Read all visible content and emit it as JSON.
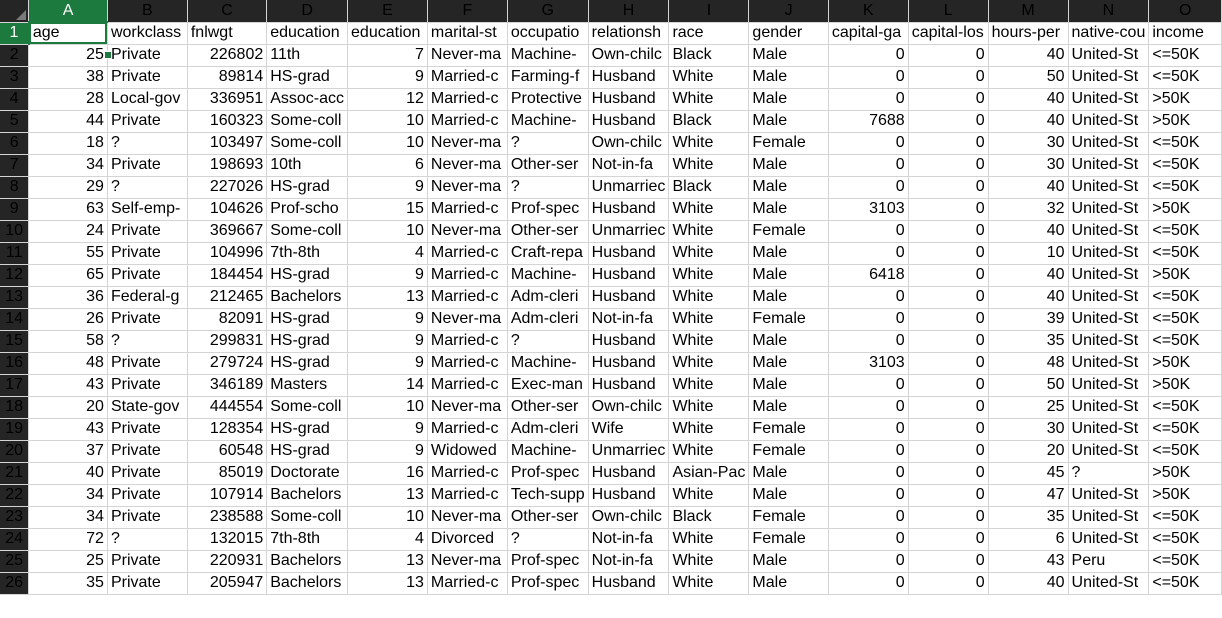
{
  "columns": [
    "A",
    "B",
    "C",
    "D",
    "E",
    "F",
    "G",
    "H",
    "I",
    "J",
    "K",
    "L",
    "M",
    "N",
    "O"
  ],
  "column_types": [
    "num",
    "txt",
    "num",
    "txt",
    "num",
    "txt",
    "txt",
    "txt",
    "txt",
    "txt",
    "num",
    "num",
    "num",
    "txt",
    "txt"
  ],
  "active_cell": {
    "col": "A",
    "row": 1
  },
  "colors": {
    "accent": "#1d7a3e",
    "header_bg": "#252525",
    "grid_line": "#d4d4d4"
  },
  "rows": [
    {
      "num": "1",
      "cells": [
        "age",
        "workclass",
        "fnlwgt",
        "education",
        "education",
        "marital-st",
        "occupatio",
        "relationsh",
        "race",
        "gender",
        "capital-ga",
        "capital-los",
        "hours-per",
        "native-cou",
        "income"
      ],
      "header": true
    },
    {
      "num": "2",
      "cells": [
        "25",
        "Private",
        "226802",
        "11th",
        "7",
        "Never-ma",
        "Machine-",
        "Own-chilc",
        "Black",
        "Male",
        "0",
        "0",
        "40",
        "United-St",
        "<=50K"
      ]
    },
    {
      "num": "3",
      "cells": [
        "38",
        "Private",
        "89814",
        "HS-grad",
        "9",
        "Married-c",
        "Farming-f",
        "Husband",
        "White",
        "Male",
        "0",
        "0",
        "50",
        "United-St",
        "<=50K"
      ]
    },
    {
      "num": "4",
      "cells": [
        "28",
        "Local-gov",
        "336951",
        "Assoc-acc",
        "12",
        "Married-c",
        "Protective",
        "Husband",
        "White",
        "Male",
        "0",
        "0",
        "40",
        "United-St",
        ">50K"
      ]
    },
    {
      "num": "5",
      "cells": [
        "44",
        "Private",
        "160323",
        "Some-coll",
        "10",
        "Married-c",
        "Machine-",
        "Husband",
        "Black",
        "Male",
        "7688",
        "0",
        "40",
        "United-St",
        ">50K"
      ]
    },
    {
      "num": "6",
      "cells": [
        "18",
        "?",
        "103497",
        "Some-coll",
        "10",
        "Never-ma",
        "?",
        "Own-chilc",
        "White",
        "Female",
        "0",
        "0",
        "30",
        "United-St",
        "<=50K"
      ]
    },
    {
      "num": "7",
      "cells": [
        "34",
        "Private",
        "198693",
        "10th",
        "6",
        "Never-ma",
        "Other-ser",
        "Not-in-fa",
        "White",
        "Male",
        "0",
        "0",
        "30",
        "United-St",
        "<=50K"
      ]
    },
    {
      "num": "8",
      "cells": [
        "29",
        "?",
        "227026",
        "HS-grad",
        "9",
        "Never-ma",
        "?",
        "Unmarriec",
        "Black",
        "Male",
        "0",
        "0",
        "40",
        "United-St",
        "<=50K"
      ]
    },
    {
      "num": "9",
      "cells": [
        "63",
        "Self-emp-",
        "104626",
        "Prof-scho",
        "15",
        "Married-c",
        "Prof-spec",
        "Husband",
        "White",
        "Male",
        "3103",
        "0",
        "32",
        "United-St",
        ">50K"
      ]
    },
    {
      "num": "10",
      "cells": [
        "24",
        "Private",
        "369667",
        "Some-coll",
        "10",
        "Never-ma",
        "Other-ser",
        "Unmarriec",
        "White",
        "Female",
        "0",
        "0",
        "40",
        "United-St",
        "<=50K"
      ]
    },
    {
      "num": "11",
      "cells": [
        "55",
        "Private",
        "104996",
        "7th-8th",
        "4",
        "Married-c",
        "Craft-repa",
        "Husband",
        "White",
        "Male",
        "0",
        "0",
        "10",
        "United-St",
        "<=50K"
      ]
    },
    {
      "num": "12",
      "cells": [
        "65",
        "Private",
        "184454",
        "HS-grad",
        "9",
        "Married-c",
        "Machine-",
        "Husband",
        "White",
        "Male",
        "6418",
        "0",
        "40",
        "United-St",
        ">50K"
      ]
    },
    {
      "num": "13",
      "cells": [
        "36",
        "Federal-g",
        "212465",
        "Bachelors",
        "13",
        "Married-c",
        "Adm-cleri",
        "Husband",
        "White",
        "Male",
        "0",
        "0",
        "40",
        "United-St",
        "<=50K"
      ]
    },
    {
      "num": "14",
      "cells": [
        "26",
        "Private",
        "82091",
        "HS-grad",
        "9",
        "Never-ma",
        "Adm-cleri",
        "Not-in-fa",
        "White",
        "Female",
        "0",
        "0",
        "39",
        "United-St",
        "<=50K"
      ]
    },
    {
      "num": "15",
      "cells": [
        "58",
        "?",
        "299831",
        "HS-grad",
        "9",
        "Married-c",
        "?",
        "Husband",
        "White",
        "Male",
        "0",
        "0",
        "35",
        "United-St",
        "<=50K"
      ]
    },
    {
      "num": "16",
      "cells": [
        "48",
        "Private",
        "279724",
        "HS-grad",
        "9",
        "Married-c",
        "Machine-",
        "Husband",
        "White",
        "Male",
        "3103",
        "0",
        "48",
        "United-St",
        ">50K"
      ]
    },
    {
      "num": "17",
      "cells": [
        "43",
        "Private",
        "346189",
        "Masters",
        "14",
        "Married-c",
        "Exec-man",
        "Husband",
        "White",
        "Male",
        "0",
        "0",
        "50",
        "United-St",
        ">50K"
      ]
    },
    {
      "num": "18",
      "cells": [
        "20",
        "State-gov",
        "444554",
        "Some-coll",
        "10",
        "Never-ma",
        "Other-ser",
        "Own-chilc",
        "White",
        "Male",
        "0",
        "0",
        "25",
        "United-St",
        "<=50K"
      ]
    },
    {
      "num": "19",
      "cells": [
        "43",
        "Private",
        "128354",
        "HS-grad",
        "9",
        "Married-c",
        "Adm-cleri",
        "Wife",
        "White",
        "Female",
        "0",
        "0",
        "30",
        "United-St",
        "<=50K"
      ]
    },
    {
      "num": "20",
      "cells": [
        "37",
        "Private",
        "60548",
        "HS-grad",
        "9",
        "Widowed",
        "Machine-",
        "Unmarriec",
        "White",
        "Female",
        "0",
        "0",
        "20",
        "United-St",
        "<=50K"
      ]
    },
    {
      "num": "21",
      "cells": [
        "40",
        "Private",
        "85019",
        "Doctorate",
        "16",
        "Married-c",
        "Prof-spec",
        "Husband",
        "Asian-Pac",
        "Male",
        "0",
        "0",
        "45",
        "?",
        ">50K"
      ]
    },
    {
      "num": "22",
      "cells": [
        "34",
        "Private",
        "107914",
        "Bachelors",
        "13",
        "Married-c",
        "Tech-supp",
        "Husband",
        "White",
        "Male",
        "0",
        "0",
        "47",
        "United-St",
        ">50K"
      ]
    },
    {
      "num": "23",
      "cells": [
        "34",
        "Private",
        "238588",
        "Some-coll",
        "10",
        "Never-ma",
        "Other-ser",
        "Own-chilc",
        "Black",
        "Female",
        "0",
        "0",
        "35",
        "United-St",
        "<=50K"
      ]
    },
    {
      "num": "24",
      "cells": [
        "72",
        "?",
        "132015",
        "7th-8th",
        "4",
        "Divorced",
        "?",
        "Not-in-fa",
        "White",
        "Female",
        "0",
        "0",
        "6",
        "United-St",
        "<=50K"
      ]
    },
    {
      "num": "25",
      "cells": [
        "25",
        "Private",
        "220931",
        "Bachelors",
        "13",
        "Never-ma",
        "Prof-spec",
        "Not-in-fa",
        "White",
        "Male",
        "0",
        "0",
        "43",
        "Peru",
        "<=50K"
      ]
    },
    {
      "num": "26",
      "cells": [
        "35",
        "Private",
        "205947",
        "Bachelors",
        "13",
        "Married-c",
        "Prof-spec",
        "Husband",
        "White",
        "Male",
        "0",
        "0",
        "40",
        "United-St",
        "<=50K"
      ]
    }
  ]
}
